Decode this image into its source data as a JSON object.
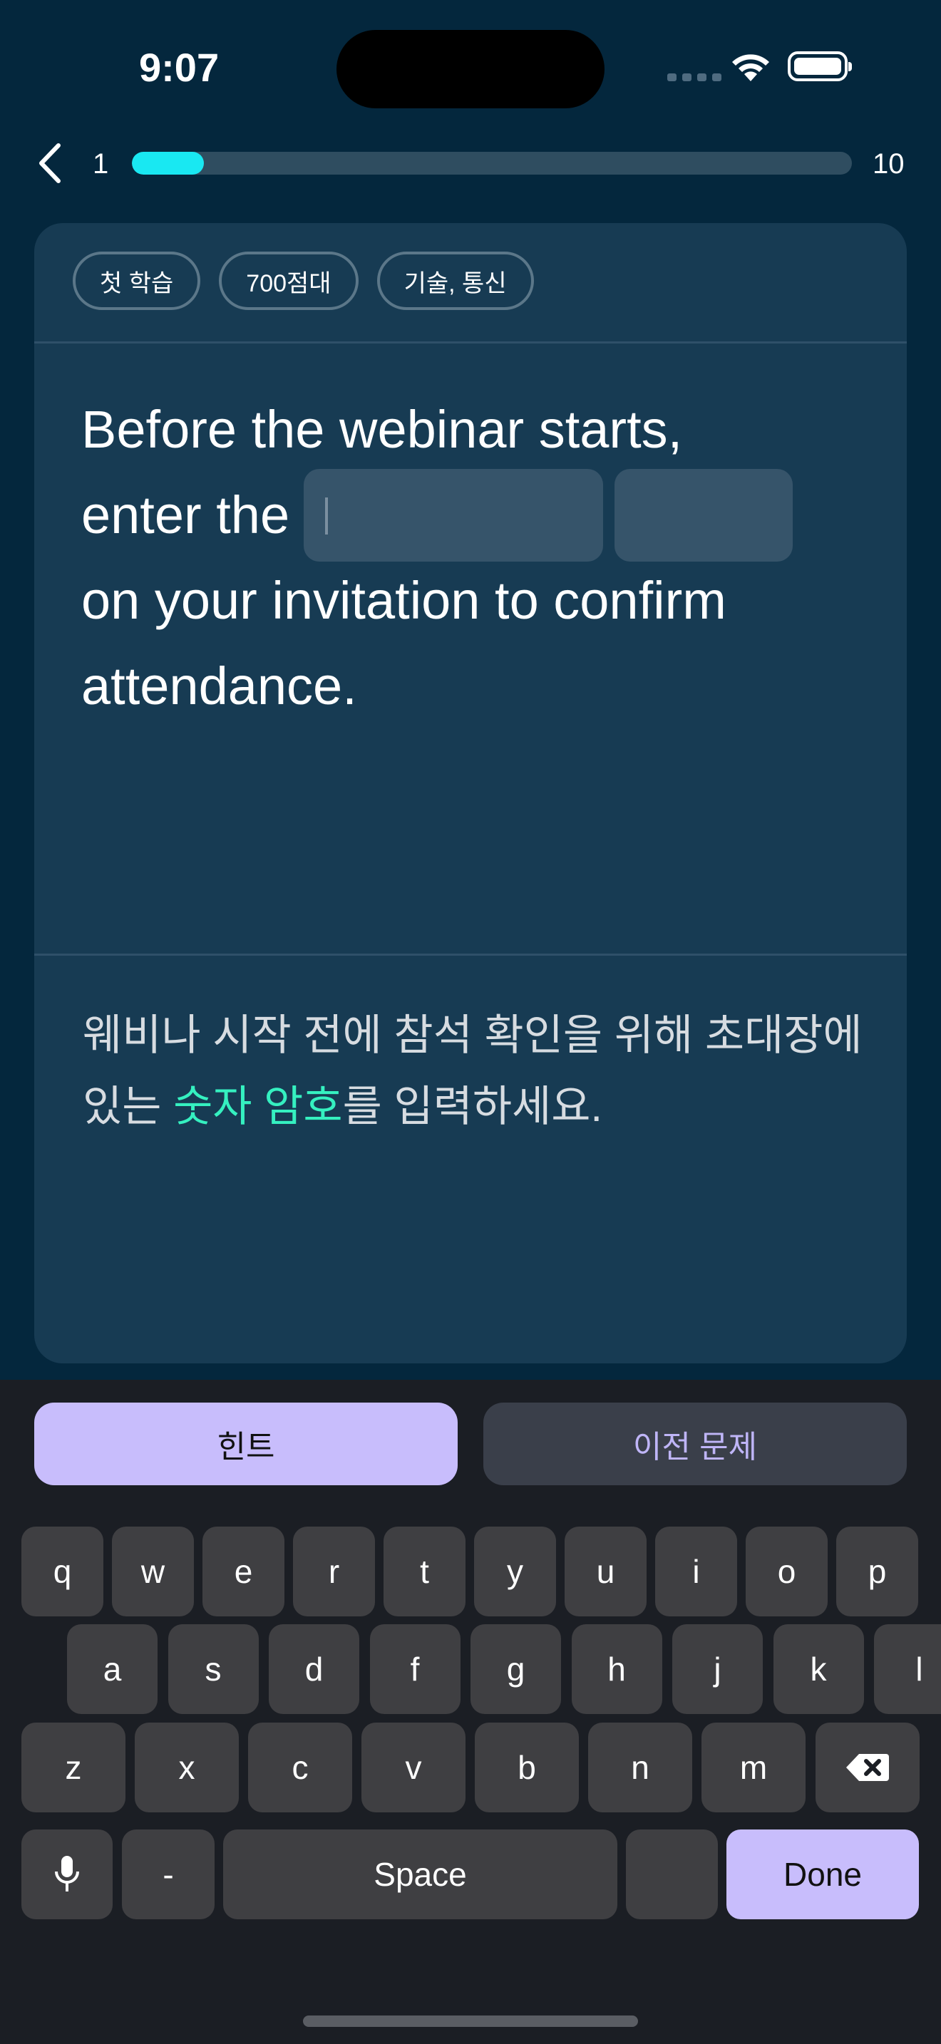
{
  "status_bar": {
    "time": "9:07",
    "icons": [
      "signal-dots-icon",
      "wifi-icon",
      "battery-icon"
    ]
  },
  "nav": {
    "back_icon": "chevron-left-icon",
    "progress_current": "1",
    "progress_total": "10",
    "progress_fraction": 0.1,
    "progress_color": "#19e8f2"
  },
  "card": {
    "chips": [
      "첫 학습",
      "700점대",
      "기술, 통신"
    ],
    "question": {
      "line1": "Before the webinar starts,",
      "line2_prefix": "enter the",
      "line3": "on your invitation to confirm",
      "line4": "attendance."
    },
    "translation": {
      "before": "웨비나 시작 전에 참석 확인을 위해 초대장에 있는 ",
      "highlight": "숫자 암호",
      "after": "를 입력하세요."
    },
    "highlight_color": "#35f0c0"
  },
  "actions": {
    "hint_label": "힌트",
    "previous_label": "이전 문제"
  },
  "keyboard": {
    "row1": [
      "q",
      "w",
      "e",
      "r",
      "t",
      "y",
      "u",
      "i",
      "o",
      "p"
    ],
    "row2": [
      "a",
      "s",
      "d",
      "f",
      "g",
      "h",
      "j",
      "k",
      "l"
    ],
    "row3": [
      "z",
      "x",
      "c",
      "v",
      "b",
      "n",
      "m"
    ],
    "delete_icon": "backspace-icon",
    "mic_icon": "microphone-icon",
    "dash_label": "-",
    "space_label": "Space",
    "blank_key_label": "",
    "done_label": "Done"
  }
}
